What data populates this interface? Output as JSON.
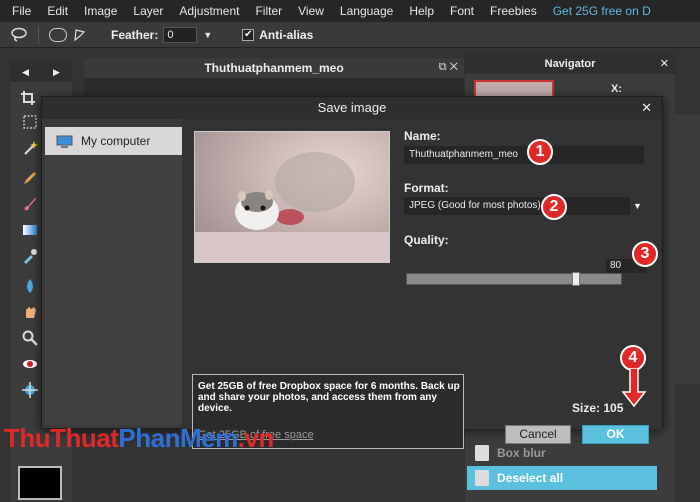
{
  "menubar": {
    "items": [
      "File",
      "Edit",
      "Image",
      "Layer",
      "Adjustment",
      "Filter",
      "View",
      "Language",
      "Help",
      "Font",
      "Freebies"
    ],
    "promo": "Get 25G free on D"
  },
  "options": {
    "feather_label": "Feather:",
    "feather_value": "0",
    "antialias_label": "Anti-alias",
    "antialias_checked": "✔"
  },
  "canvas": {
    "title": "Thuthuatphanmem_meo"
  },
  "navigator": {
    "title": "Navigator",
    "x_label": "X:"
  },
  "history": {
    "items": [
      {
        "label": "Box blur"
      },
      {
        "label": "Deselect all"
      }
    ]
  },
  "dialog": {
    "title": "Save image",
    "location": "My computer",
    "name_label": "Name:",
    "name_value": "Thuthuatphanmem_meo",
    "format_label": "Format:",
    "format_value": "JPEG (Good for most photos)",
    "quality_label": "Quality:",
    "quality_value": "80",
    "quality_fraction": 0.8,
    "promo_text": "Get 25GB of free Dropbox space for 6 months. Back up and share your photos, and access them from any device.",
    "promo_link": "Get 25GB of free space",
    "size_text": "Size: 105",
    "cancel_label": "Cancel",
    "ok_label": "OK"
  },
  "badges": [
    "1",
    "2",
    "3",
    "4"
  ],
  "watermark": {
    "part1": "ThuThuat",
    "part2": "PhanMem",
    "part3": ".vn"
  },
  "colors": {
    "accent": "#5bc0de",
    "badge": "#e02828",
    "promo_link": "#5fb8e0"
  }
}
